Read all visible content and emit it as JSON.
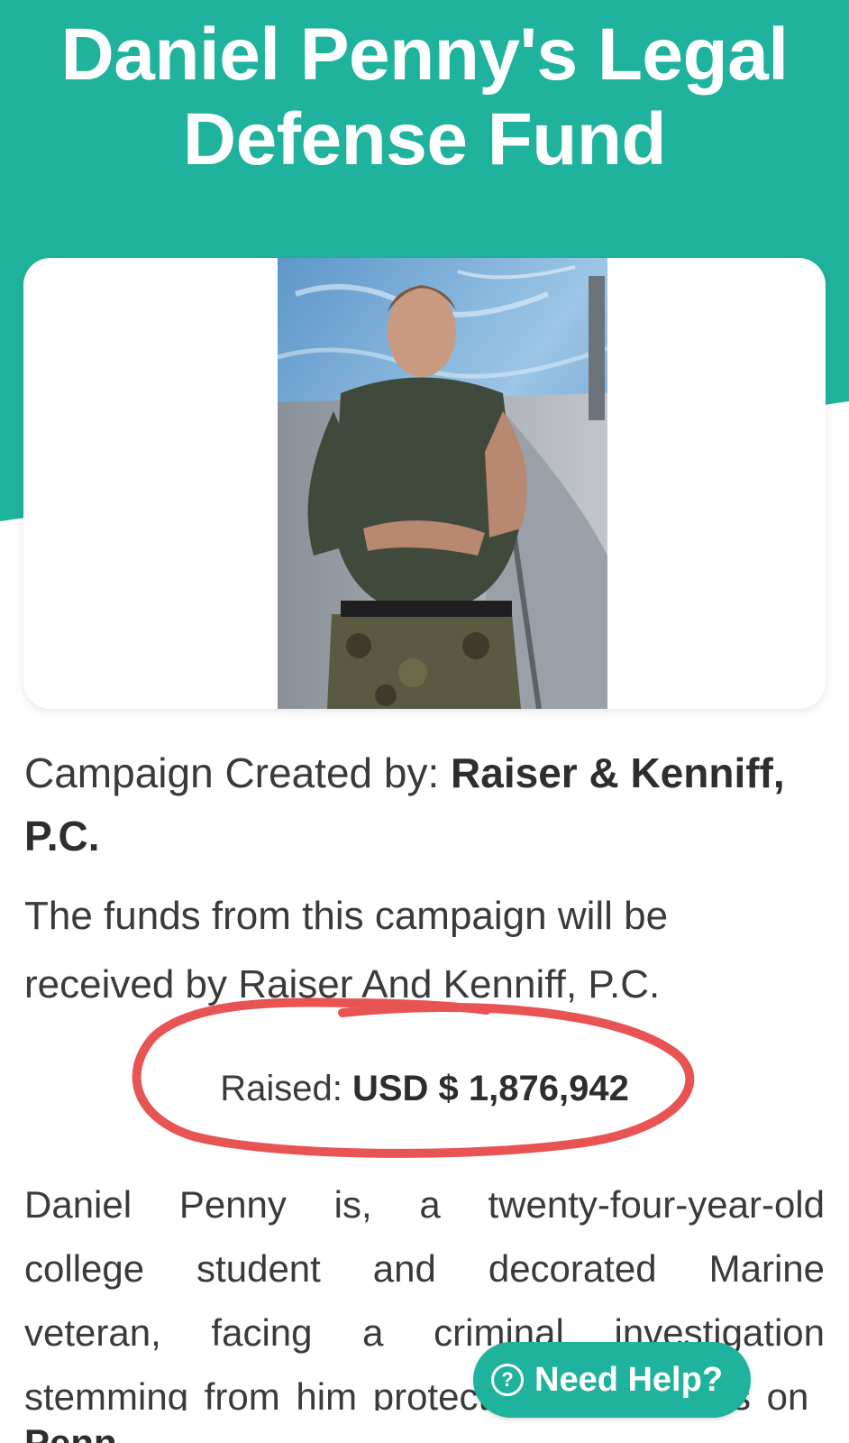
{
  "theme": {
    "accent": "#1fb39d",
    "annotation": "#e85454"
  },
  "header": {
    "title": "Daniel Penny's Legal Defense Fund"
  },
  "campaign": {
    "creator_prefix": "Campaign Created by: ",
    "creator_name": "Raiser & Kenniff, P.C.",
    "funds_text": "The funds from this campaign will be received by Raiser And Kenniff, P.C."
  },
  "raised": {
    "label": "Raised: ",
    "amount": "USD $ 1,876,942"
  },
  "story": {
    "text": "Daniel Penny is, a twenty-four-year-old college student and decorated Marine veteran, facing a criminal investigation stemming from him protecting passengers on",
    "next_word": "Penn"
  },
  "help": {
    "label": "Need Help?",
    "icon": "question-circle-icon",
    "icon_glyph": "?"
  }
}
